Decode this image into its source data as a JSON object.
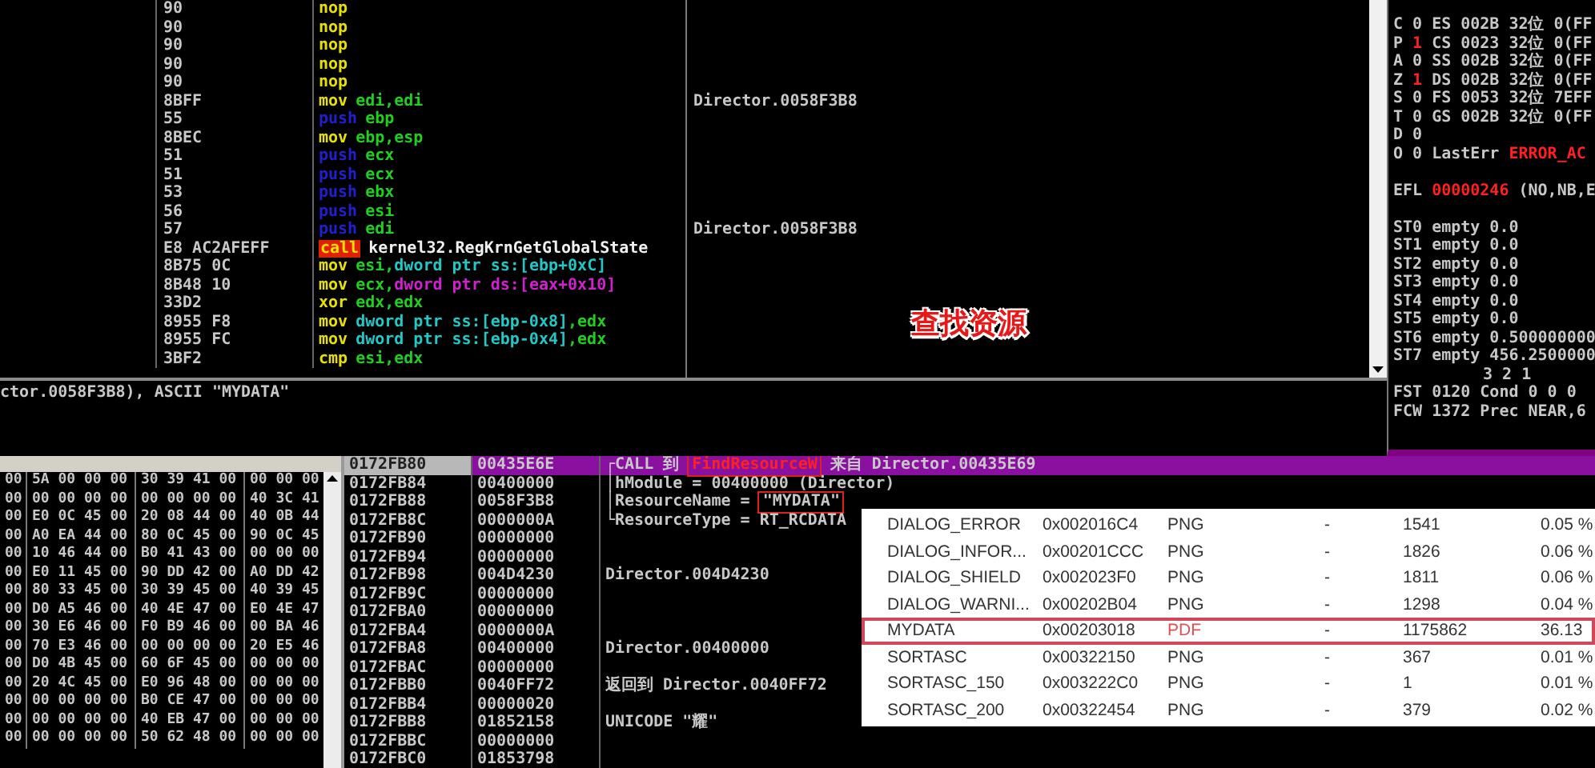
{
  "disassembly": {
    "rows": [
      {
        "bytes": "90",
        "mnemonic": "nop",
        "kind": "plain",
        "operands": []
      },
      {
        "bytes": "90",
        "mnemonic": "nop",
        "kind": "plain",
        "operands": []
      },
      {
        "bytes": "90",
        "mnemonic": "nop",
        "kind": "plain",
        "operands": []
      },
      {
        "bytes": "90",
        "mnemonic": "nop",
        "kind": "plain",
        "operands": []
      },
      {
        "bytes": "90",
        "mnemonic": "nop",
        "kind": "plain",
        "operands": []
      },
      {
        "bytes": "8BFF",
        "mnemonic": "mov",
        "kind": "plain",
        "operands": [
          {
            "text": "edi,edi",
            "kind": "reg"
          }
        ],
        "comment": "Director.0058F3B8"
      },
      {
        "bytes": "55",
        "mnemonic": "push",
        "kind": "stack",
        "operands": [
          {
            "text": "ebp",
            "kind": "reg"
          }
        ]
      },
      {
        "bytes": "8BEC",
        "mnemonic": "mov",
        "kind": "plain",
        "operands": [
          {
            "text": "ebp,esp",
            "kind": "reg"
          }
        ]
      },
      {
        "bytes": "51",
        "mnemonic": "push",
        "kind": "stack",
        "operands": [
          {
            "text": "ecx",
            "kind": "reg"
          }
        ]
      },
      {
        "bytes": "51",
        "mnemonic": "push",
        "kind": "stack",
        "operands": [
          {
            "text": "ecx",
            "kind": "reg"
          }
        ]
      },
      {
        "bytes": "53",
        "mnemonic": "push",
        "kind": "stack",
        "operands": [
          {
            "text": "ebx",
            "kind": "reg"
          }
        ]
      },
      {
        "bytes": "56",
        "mnemonic": "push",
        "kind": "stack",
        "operands": [
          {
            "text": "esi",
            "kind": "reg"
          }
        ]
      },
      {
        "bytes": "57",
        "mnemonic": "push",
        "kind": "stack",
        "operands": [
          {
            "text": "edi",
            "kind": "reg"
          }
        ],
        "comment": "Director.0058F3B8"
      },
      {
        "bytes": "E8 AC2AFEFF",
        "mnemonic": "call",
        "kind": "call",
        "operands": [
          {
            "text": "kernel32.RegKrnGetGlobalState",
            "kind": "symbol"
          }
        ]
      },
      {
        "bytes": "8B75 0C",
        "mnemonic": "mov",
        "kind": "plain",
        "operands": [
          {
            "text": "esi,",
            "kind": "reg"
          },
          {
            "text": "dword ptr ss:[ebp+0xC]",
            "kind": "mem_ss"
          }
        ]
      },
      {
        "bytes": "8B48 10",
        "mnemonic": "mov",
        "kind": "plain",
        "operands": [
          {
            "text": "ecx,",
            "kind": "reg"
          },
          {
            "text": "dword ptr ds:[eax+0x10]",
            "kind": "mem_ds"
          }
        ]
      },
      {
        "bytes": "33D2",
        "mnemonic": "xor",
        "kind": "plain",
        "operands": [
          {
            "text": "edx,edx",
            "kind": "reg"
          }
        ]
      },
      {
        "bytes": "8955 F8",
        "mnemonic": "mov",
        "kind": "plain",
        "operands": [
          {
            "text": "dword ptr ss:[ebp-0x8]",
            "kind": "mem_ss"
          },
          {
            "text": ",edx",
            "kind": "reg"
          }
        ]
      },
      {
        "bytes": "8955 FC",
        "mnemonic": "mov",
        "kind": "plain",
        "operands": [
          {
            "text": "dword ptr ss:[ebp-0x4]",
            "kind": "mem_ss"
          },
          {
            "text": ",edx",
            "kind": "reg"
          }
        ]
      },
      {
        "bytes": "3BF2",
        "mnemonic": "cmp",
        "kind": "plain",
        "operands": [
          {
            "text": "esi,edx",
            "kind": "reg"
          }
        ]
      }
    ]
  },
  "annotation": "查找资源",
  "info_line": "ctor.0058F3B8), ASCII \"MYDATA\"",
  "registers": [
    {
      "segments": [
        {
          "text": "C",
          "kind": "label"
        },
        {
          "text": "0",
          "kind": "normal"
        },
        {
          "text": "ES",
          "kind": "label"
        },
        {
          "text": "002B",
          "kind": "normal"
        },
        {
          "text": "32位",
          "kind": "normal"
        },
        {
          "text": "0(FF",
          "kind": "normal"
        }
      ]
    },
    {
      "segments": [
        {
          "text": "P",
          "kind": "label"
        },
        {
          "text": "1",
          "kind": "changed"
        },
        {
          "text": "CS",
          "kind": "label"
        },
        {
          "text": "0023",
          "kind": "normal"
        },
        {
          "text": "32位",
          "kind": "normal"
        },
        {
          "text": "0(FF",
          "kind": "normal"
        }
      ]
    },
    {
      "segments": [
        {
          "text": "A",
          "kind": "label"
        },
        {
          "text": "0",
          "kind": "normal"
        },
        {
          "text": "SS",
          "kind": "label"
        },
        {
          "text": "002B",
          "kind": "normal"
        },
        {
          "text": "32位",
          "kind": "normal"
        },
        {
          "text": "0(FF",
          "kind": "normal"
        }
      ]
    },
    {
      "segments": [
        {
          "text": "Z",
          "kind": "label"
        },
        {
          "text": "1",
          "kind": "changed"
        },
        {
          "text": "DS",
          "kind": "label"
        },
        {
          "text": "002B",
          "kind": "normal"
        },
        {
          "text": "32位",
          "kind": "normal"
        },
        {
          "text": "0(FF",
          "kind": "normal"
        }
      ]
    },
    {
      "segments": [
        {
          "text": "S",
          "kind": "label"
        },
        {
          "text": "0",
          "kind": "normal"
        },
        {
          "text": "FS",
          "kind": "label"
        },
        {
          "text": "0053",
          "kind": "normal"
        },
        {
          "text": "32位",
          "kind": "normal"
        },
        {
          "text": "7EFF",
          "kind": "normal"
        }
      ]
    },
    {
      "segments": [
        {
          "text": "T",
          "kind": "label"
        },
        {
          "text": "0",
          "kind": "normal"
        },
        {
          "text": "GS",
          "kind": "label"
        },
        {
          "text": "002B",
          "kind": "normal"
        },
        {
          "text": "32位",
          "kind": "normal"
        },
        {
          "text": "0(FF",
          "kind": "normal"
        }
      ]
    },
    {
      "segments": [
        {
          "text": "D",
          "kind": "label"
        },
        {
          "text": "0",
          "kind": "normal"
        }
      ]
    },
    {
      "segments": [
        {
          "text": "O",
          "kind": "label"
        },
        {
          "text": "0",
          "kind": "normal"
        },
        {
          "text": "LastErr",
          "kind": "label"
        },
        {
          "text": "ERROR_AC",
          "kind": "changed"
        }
      ]
    },
    {
      "kind": "spacer"
    },
    {
      "segments": [
        {
          "text": "EFL",
          "kind": "label"
        },
        {
          "text": "00000246",
          "kind": "changed"
        },
        {
          "text": "(NO,NB,E",
          "kind": "normal"
        }
      ]
    },
    {
      "kind": "spacer"
    },
    {
      "segments": [
        {
          "text": "ST0",
          "kind": "label"
        },
        {
          "text": "empty",
          "kind": "normal"
        },
        {
          "text": "0.0",
          "kind": "normal"
        }
      ]
    },
    {
      "segments": [
        {
          "text": "ST1",
          "kind": "label"
        },
        {
          "text": "empty",
          "kind": "normal"
        },
        {
          "text": "0.0",
          "kind": "normal"
        }
      ]
    },
    {
      "segments": [
        {
          "text": "ST2",
          "kind": "label"
        },
        {
          "text": "empty",
          "kind": "normal"
        },
        {
          "text": "0.0",
          "kind": "normal"
        }
      ]
    },
    {
      "segments": [
        {
          "text": "ST3",
          "kind": "label"
        },
        {
          "text": "empty",
          "kind": "normal"
        },
        {
          "text": "0.0",
          "kind": "normal"
        }
      ]
    },
    {
      "segments": [
        {
          "text": "ST4",
          "kind": "label"
        },
        {
          "text": "empty",
          "kind": "normal"
        },
        {
          "text": "0.0",
          "kind": "normal"
        }
      ]
    },
    {
      "segments": [
        {
          "text": "ST5",
          "kind": "label"
        },
        {
          "text": "empty",
          "kind": "normal"
        },
        {
          "text": "0.0",
          "kind": "normal"
        }
      ]
    },
    {
      "segments": [
        {
          "text": "ST6",
          "kind": "label"
        },
        {
          "text": "empty",
          "kind": "normal"
        },
        {
          "text": "0.500000000",
          "kind": "normal"
        }
      ]
    },
    {
      "segments": [
        {
          "text": "ST7",
          "kind": "label"
        },
        {
          "text": "empty",
          "kind": "normal"
        },
        {
          "text": "456.2500000",
          "kind": "normal"
        }
      ]
    },
    {
      "segments": [
        {
          "text": "3 2 1",
          "kind": "indent"
        }
      ]
    },
    {
      "segments": [
        {
          "text": "FST",
          "kind": "label"
        },
        {
          "text": "0120",
          "kind": "normal"
        },
        {
          "text": "Cond",
          "kind": "label"
        },
        {
          "text": "0 0 0",
          "kind": "normal"
        }
      ]
    },
    {
      "segments": [
        {
          "text": "FCW",
          "kind": "label"
        },
        {
          "text": "1372",
          "kind": "normal"
        },
        {
          "text": "Prec",
          "kind": "label"
        },
        {
          "text": "NEAR,6",
          "kind": "normal"
        }
      ]
    }
  ],
  "hex_dump": {
    "rows": [
      [
        "00",
        "5A 00 00 00",
        "30 39 41 00",
        "00 00 00"
      ],
      [
        "00",
        "00 00 00 00",
        "00 00 00 00",
        "40 3C 41"
      ],
      [
        "00",
        "E0 0C 45 00",
        "20 08 44 00",
        "40 0B 44"
      ],
      [
        "00",
        "A0 EA 44 00",
        "80 0C 45 00",
        "90 0C 45"
      ],
      [
        "00",
        "10 46 44 00",
        "B0 41 43 00",
        "00 00 00"
      ],
      [
        "00",
        "E0 11 45 00",
        "90 DD 42 00",
        "A0 DD 42"
      ],
      [
        "00",
        "80 33 45 00",
        "30 39 45 00",
        "40 39 45"
      ],
      [
        "00",
        "D0 A5 46 00",
        "40 4E 47 00",
        "E0 4E 47"
      ],
      [
        "00",
        "30 E6 46 00",
        "F0 B9 46 00",
        "00 BA 46"
      ],
      [
        "00",
        "70 E3 46 00",
        "00 00 00 00",
        "20 E5 46"
      ],
      [
        "00",
        "D0 4B 45 00",
        "60 6F 45 00",
        "00 00 00"
      ],
      [
        "00",
        "20 4C 45 00",
        "E0 96 48 00",
        "00 00 00"
      ],
      [
        "00",
        "00 00 00 00",
        "B0 CE 47 00",
        "00 00 00"
      ],
      [
        "00",
        "00 00 00 00",
        "40 EB 47 00",
        "00 00 00"
      ],
      [
        "00",
        "00 00 00 00",
        "50 62 48 00",
        "00 00 00"
      ]
    ]
  },
  "stack": {
    "rows": [
      {
        "address": "0172FB80",
        "value": "00435E6E",
        "selected": true,
        "comment": [
          {
            "text": "┌CALL 到",
            "kind": "plain"
          },
          {
            "text": "FindResourceW",
            "kind": "red_boxed"
          },
          {
            "text": "来自 Director.00435E69",
            "kind": "plain"
          }
        ]
      },
      {
        "address": "0172FB84",
        "value": "00400000",
        "selected": false,
        "comment": [
          {
            "text": "│hModule = 00400000 (Director)",
            "kind": "plain"
          }
        ]
      },
      {
        "address": "0172FB88",
        "value": "0058F3B8",
        "selected": false,
        "comment": [
          {
            "text": "│ResourceName =",
            "kind": "plain"
          },
          {
            "text": "\"MYDATA\"",
            "kind": "boxed"
          }
        ]
      },
      {
        "address": "0172FB8C",
        "value": "0000000A",
        "selected": false,
        "comment": [
          {
            "text": "└ResourceType = RT_RCDATA",
            "kind": "plain"
          }
        ]
      },
      {
        "address": "0172FB90",
        "value": "00000000",
        "selected": false,
        "comment": []
      },
      {
        "address": "0172FB94",
        "value": "00000000",
        "selected": false,
        "comment": []
      },
      {
        "address": "0172FB98",
        "value": "004D4230",
        "selected": false,
        "comment": [
          {
            "text": "Director.004D4230",
            "kind": "plain"
          }
        ]
      },
      {
        "address": "0172FB9C",
        "value": "00000000",
        "selected": false,
        "comment": []
      },
      {
        "address": "0172FBA0",
        "value": "00000000",
        "selected": false,
        "comment": []
      },
      {
        "address": "0172FBA4",
        "value": "0000000A",
        "selected": false,
        "comment": []
      },
      {
        "address": "0172FBA8",
        "value": "00400000",
        "selected": false,
        "comment": [
          {
            "text": "Director.00400000",
            "kind": "plain"
          }
        ]
      },
      {
        "address": "0172FBAC",
        "value": "00000000",
        "selected": false,
        "comment": []
      },
      {
        "address": "0172FBB0",
        "value": "0040FF72",
        "selected": false,
        "comment": [
          {
            "text": "返回到 Director.0040FF72",
            "kind": "plain"
          }
        ]
      },
      {
        "address": "0172FBB4",
        "value": "00000020",
        "selected": false,
        "comment": []
      },
      {
        "address": "0172FBB8",
        "value": "01852158",
        "selected": false,
        "comment": [
          {
            "text": "UNICODE \"耀\"",
            "kind": "plain"
          }
        ]
      },
      {
        "address": "0172FBBC",
        "value": "00000000",
        "selected": false,
        "comment": []
      },
      {
        "address": "0172FBC0",
        "value": "01853798",
        "selected": false,
        "comment": []
      }
    ]
  },
  "resource_table": {
    "rows": [
      {
        "name": "DIALOG_ERROR",
        "offset": "0x002016C4",
        "type": "PNG",
        "column_4": "-",
        "size": "1541",
        "percent": "0.05 %",
        "highlighted": false
      },
      {
        "name": "DIALOG_INFOR...",
        "offset": "0x00201CCC",
        "type": "PNG",
        "column_4": "-",
        "size": "1826",
        "percent": "0.06 %",
        "highlighted": false
      },
      {
        "name": "DIALOG_SHIELD",
        "offset": "0x002023F0",
        "type": "PNG",
        "column_4": "-",
        "size": "1811",
        "percent": "0.06 %",
        "highlighted": false
      },
      {
        "name": "DIALOG_WARNI...",
        "offset": "0x00202B04",
        "type": "PNG",
        "column_4": "-",
        "size": "1298",
        "percent": "0.04 %",
        "highlighted": false
      },
      {
        "name": "MYDATA",
        "offset": "0x00203018",
        "type": "PDF",
        "column_4": "-",
        "size": "1175862",
        "percent": "36.13",
        "highlighted": true
      },
      {
        "name": "SORTASC",
        "offset": "0x00322150",
        "type": "PNG",
        "column_4": "-",
        "size": "367",
        "percent": "0.01 %",
        "highlighted": false
      },
      {
        "name": "SORTASC_150",
        "offset": "0x003222C0",
        "type": "PNG",
        "column_4": "-",
        "size": "1",
        "percent": "0.01 %",
        "highlighted": false
      },
      {
        "name": "SORTASC_200",
        "offset": "0x00322454",
        "type": "PNG",
        "column_4": "-",
        "size": "379",
        "percent": "0.02 %",
        "highlighted": false
      }
    ]
  }
}
